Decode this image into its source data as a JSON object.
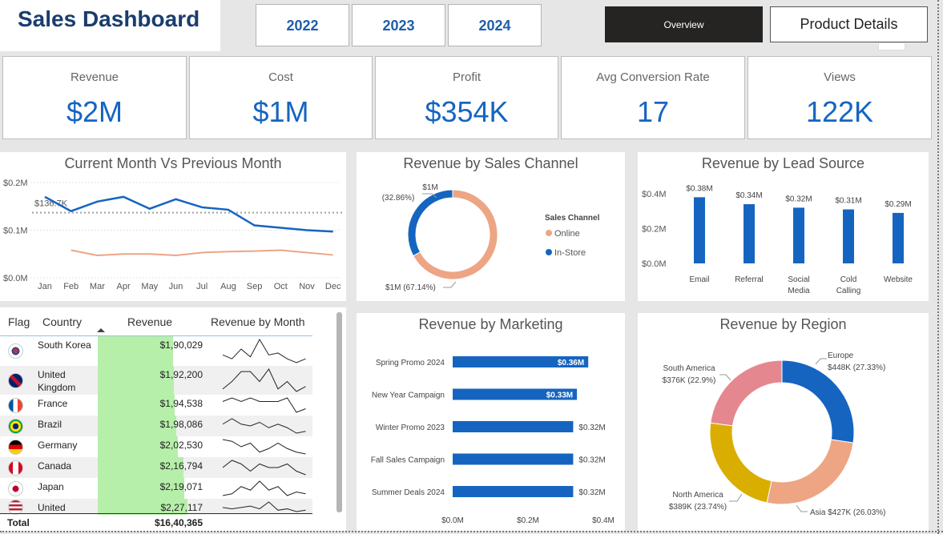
{
  "header": {
    "title": "Sales Dashboard",
    "years": [
      "2022",
      "2023",
      "2024"
    ],
    "nav_overview": "Overview",
    "nav_product_details": "Product Details"
  },
  "kpis": [
    {
      "label": "Revenue",
      "value": "$2M"
    },
    {
      "label": "Cost",
      "value": "$1M"
    },
    {
      "label": "Profit",
      "value": "$354K"
    },
    {
      "label": "Avg Conversion Rate",
      "value": "17"
    },
    {
      "label": "Views",
      "value": "122K"
    }
  ],
  "colors": {
    "blue": "#1565c0",
    "salmon": "#eda584",
    "yellow": "#d9ae00",
    "pink": "#e5878f",
    "green_bar": "#b6efa9",
    "dark": "#252423"
  },
  "panels": {
    "month_title": "Current Month Vs Previous Month",
    "channel_title": "Revenue by Sales Channel",
    "lead_title": "Revenue by Lead Source",
    "marketing_title": "Revenue by Marketing",
    "region_title": "Revenue by Region"
  },
  "table": {
    "headers": {
      "flag": "Flag",
      "country": "Country",
      "revenue": "Revenue",
      "by_month": "Revenue by Month"
    },
    "rows": [
      {
        "flag": "south-korea",
        "country": "South Korea",
        "revenue": "$1,90,029",
        "value": 190029,
        "spark": [
          6,
          4,
          9,
          5,
          14,
          6,
          7,
          4,
          2,
          4
        ]
      },
      {
        "flag": "united-kingdom",
        "country": "United Kingdom",
        "revenue": "$1,92,200",
        "value": 192200,
        "spark": [
          3,
          6,
          10,
          10,
          6,
          11,
          3,
          6,
          2,
          4
        ]
      },
      {
        "flag": "france",
        "country": "France",
        "revenue": "$1,94,538",
        "value": 194538,
        "spark": [
          6,
          7,
          6,
          7,
          6,
          6,
          6,
          7,
          3,
          4
        ]
      },
      {
        "flag": "brazil",
        "country": "Brazil",
        "revenue": "$1,98,086",
        "value": 198086,
        "spark": [
          8,
          11,
          8,
          7,
          9,
          6,
          8,
          6,
          3,
          4
        ]
      },
      {
        "flag": "germany",
        "country": "Germany",
        "revenue": "$2,02,530",
        "value": 202530,
        "spark": [
          10,
          9,
          6,
          8,
          3,
          5,
          8,
          5,
          3,
          2
        ]
      },
      {
        "flag": "canada",
        "country": "Canada",
        "revenue": "$2,16,794",
        "value": 216794,
        "spark": [
          8,
          10,
          9,
          7,
          9,
          8,
          8,
          9,
          7,
          6
        ]
      },
      {
        "flag": "japan",
        "country": "Japan",
        "revenue": "$2,19,071",
        "value": 219071,
        "spark": [
          3,
          4,
          8,
          6,
          11,
          6,
          8,
          3,
          5,
          4
        ]
      },
      {
        "flag": "usa",
        "country": "United",
        "revenue": "$2,27,117",
        "value": 227117,
        "spark": [
          9,
          8,
          9,
          10,
          8,
          13,
          7,
          8,
          6,
          7
        ]
      }
    ],
    "total_label": "Total",
    "total_value": "$16,40,365"
  },
  "chart_data": [
    {
      "type": "line",
      "title": "Current Month Vs Previous Month",
      "x": [
        "Jan",
        "Feb",
        "Mar",
        "Apr",
        "May",
        "Jun",
        "Jul",
        "Aug",
        "Sep",
        "Oct",
        "Nov",
        "Dec"
      ],
      "ylim": [
        0,
        0.2
      ],
      "yticks": [
        "$0.0M",
        "$0.1M",
        "$0.2M"
      ],
      "series": [
        {
          "values": [
            0.17,
            0.14,
            0.16,
            0.17,
            0.145,
            0.165,
            0.148,
            0.143,
            0.11,
            0.105,
            0.1,
            0.097
          ]
        },
        {
          "values": [
            null,
            0.058,
            0.047,
            0.05,
            0.05,
            0.047,
            0.053,
            0.055,
            0.056,
            0.058,
            0.053,
            0.048
          ]
        }
      ],
      "reference_line": {
        "value": 0.1367,
        "label": "$136.7K"
      }
    },
    {
      "type": "pie",
      "title": "Revenue by Sales Channel",
      "legend_title": "Sales Channel",
      "slices": [
        {
          "name": "Online",
          "label": "$1M (67.14%)",
          "value": 67.14
        },
        {
          "name": "In-Store",
          "label": "$1M (32.86%)",
          "value": 32.86
        }
      ]
    },
    {
      "type": "bar",
      "title": "Revenue by Lead Source",
      "categories": [
        "Email",
        "Referral",
        "Social Media",
        "Cold Calling",
        "Website"
      ],
      "values": [
        0.38,
        0.34,
        0.32,
        0.31,
        0.29
      ],
      "labels": [
        "$0.38M",
        "$0.34M",
        "$0.32M",
        "$0.31M",
        "$0.29M"
      ],
      "ylim": [
        0,
        0.4
      ],
      "yticks": [
        "$0.0M",
        "$0.2M",
        "$0.4M"
      ]
    },
    {
      "type": "bar",
      "orientation": "horizontal",
      "title": "Revenue by Marketing",
      "categories": [
        "Spring Promo 2024",
        "New Year Campaign",
        "Winter Promo 2023",
        "Fall Sales Campaign",
        "Summer Deals 2024"
      ],
      "values": [
        0.36,
        0.33,
        0.32,
        0.32,
        0.32
      ],
      "labels": [
        "$0.36M",
        "$0.33M",
        "$0.32M",
        "$0.32M",
        "$0.32M"
      ],
      "xlim": [
        0,
        0.4
      ],
      "xticks": [
        "$0.0M",
        "$0.2M",
        "$0.4M"
      ]
    },
    {
      "type": "pie",
      "title": "Revenue by Region",
      "slices": [
        {
          "name": "Europe",
          "label": "$448K (27.33%)",
          "value": 27.33
        },
        {
          "name": "Asia",
          "label": "$427K (26.03%)",
          "value": 26.03
        },
        {
          "name": "North America",
          "label": "$389K (23.74%)",
          "value": 23.74
        },
        {
          "name": "South America",
          "label": "$376K (22.9%)",
          "value": 22.9
        }
      ]
    }
  ]
}
